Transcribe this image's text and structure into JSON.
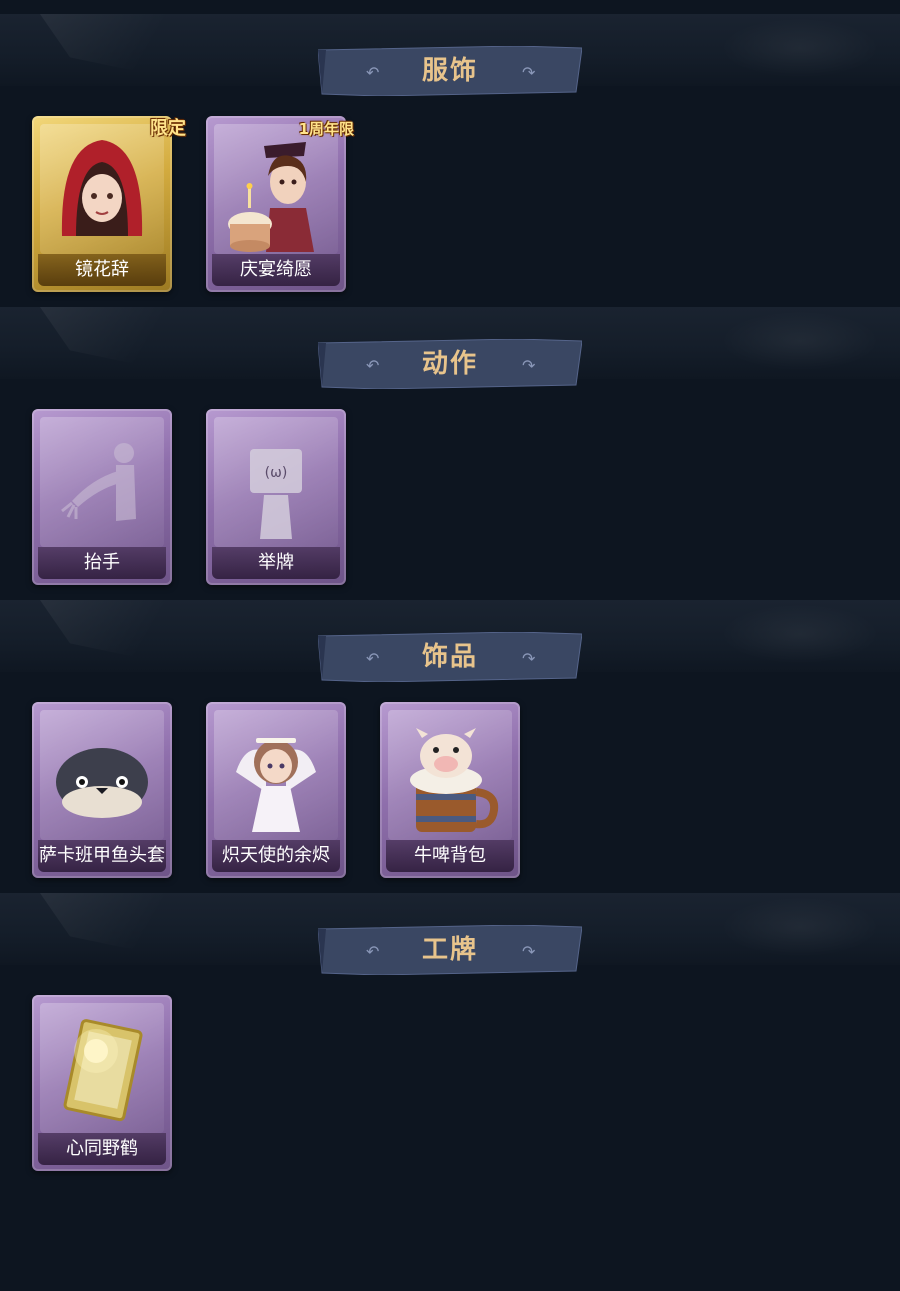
{
  "sections": [
    {
      "title": "服饰",
      "items": [
        {
          "label": "镜花辞",
          "badge": "限定",
          "frame": "gold",
          "icon": "hooded-girl-portrait-icon"
        },
        {
          "label": "庆宴绮愿",
          "badge": "1周年限",
          "frame": "purple",
          "icon": "cake-girl-portrait-icon"
        }
      ]
    },
    {
      "title": "动作",
      "items": [
        {
          "label": "抬手",
          "frame": "purple",
          "icon": "raise-hand-silhouette-icon"
        },
        {
          "label": "举牌",
          "frame": "purple",
          "icon": "hold-sign-silhouette-icon"
        }
      ]
    },
    {
      "title": "饰品",
      "items": [
        {
          "label": "萨卡班甲鱼头套",
          "frame": "purple",
          "icon": "fish-headgear-icon"
        },
        {
          "label": "炽天使的余烬",
          "frame": "purple",
          "icon": "angel-doll-icon"
        },
        {
          "label": "牛啤背包",
          "frame": "purple",
          "icon": "cow-beer-mug-icon"
        }
      ]
    },
    {
      "title": "工牌",
      "items": [
        {
          "label": "心同野鹤",
          "frame": "purple",
          "icon": "golden-badge-card-icon"
        }
      ]
    }
  ],
  "colors": {
    "background": "#0d1520",
    "banner": "#3a4763",
    "title": "#e8c48c",
    "card_purple": "#8f6fac",
    "card_gold": "#d3ab3f"
  }
}
